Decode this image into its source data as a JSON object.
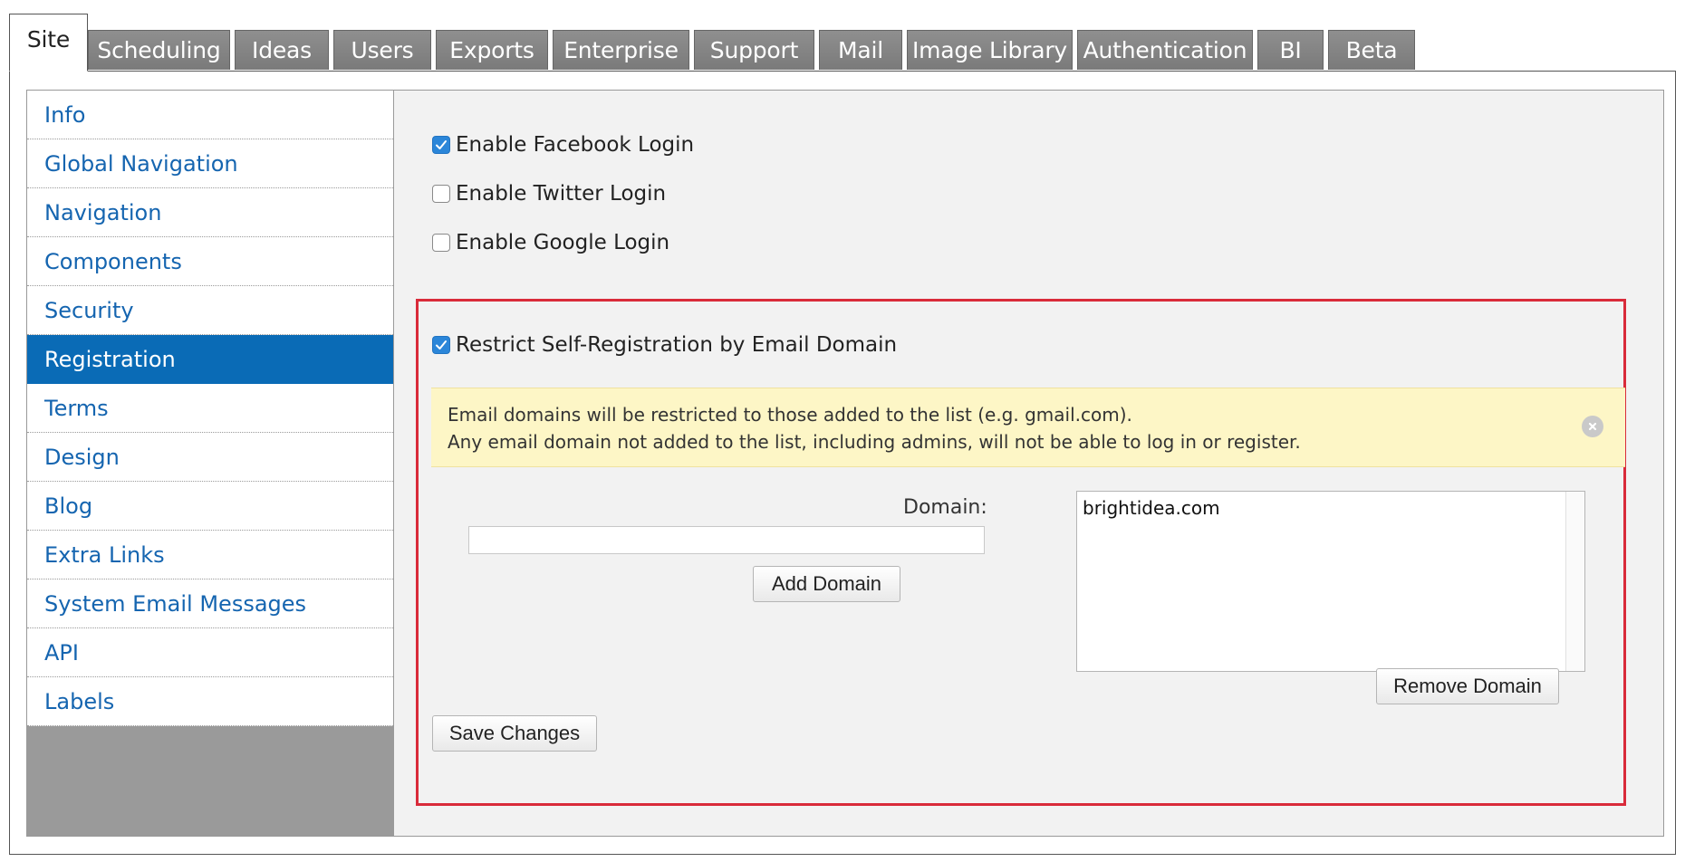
{
  "tabs": [
    {
      "label": "Site",
      "active": true
    },
    {
      "label": "Scheduling"
    },
    {
      "label": "Ideas"
    },
    {
      "label": "Users"
    },
    {
      "label": "Exports"
    },
    {
      "label": "Enterprise"
    },
    {
      "label": "Support"
    },
    {
      "label": "Mail"
    },
    {
      "label": "Image Library"
    },
    {
      "label": "Authentication"
    },
    {
      "label": "BI"
    },
    {
      "label": "Beta"
    }
  ],
  "sidebar": {
    "items": [
      {
        "label": "Info"
      },
      {
        "label": "Global Navigation"
      },
      {
        "label": "Navigation"
      },
      {
        "label": "Components"
      },
      {
        "label": "Security"
      },
      {
        "label": "Registration",
        "active": true
      },
      {
        "label": "Terms"
      },
      {
        "label": "Design"
      },
      {
        "label": "Blog"
      },
      {
        "label": "Extra Links"
      },
      {
        "label": "System Email Messages"
      },
      {
        "label": "API"
      },
      {
        "label": "Labels"
      }
    ]
  },
  "options": {
    "facebook": {
      "label": "Enable Facebook Login",
      "checked": true
    },
    "twitter": {
      "label": "Enable Twitter Login",
      "checked": false
    },
    "google": {
      "label": "Enable Google Login",
      "checked": false
    },
    "restrict": {
      "label": "Restrict Self-Registration by Email Domain",
      "checked": true
    }
  },
  "notice": {
    "line1": "Email domains will be restricted to those added to the list (e.g. gmail.com).",
    "line2": "Any email domain not added to the list, including admins, will not be able to log in or register."
  },
  "domain": {
    "label": "Domain:",
    "value": "",
    "add_label": "Add Domain",
    "list": [
      "brightidea.com"
    ],
    "remove_label": "Remove Domain"
  },
  "save_label": "Save Changes",
  "colors": {
    "accent": "#0a6bb6",
    "link": "#1565b0",
    "highlight_border": "#d92b3a",
    "notice_bg": "#fdf6c6",
    "checkbox": "#2b86d9"
  }
}
